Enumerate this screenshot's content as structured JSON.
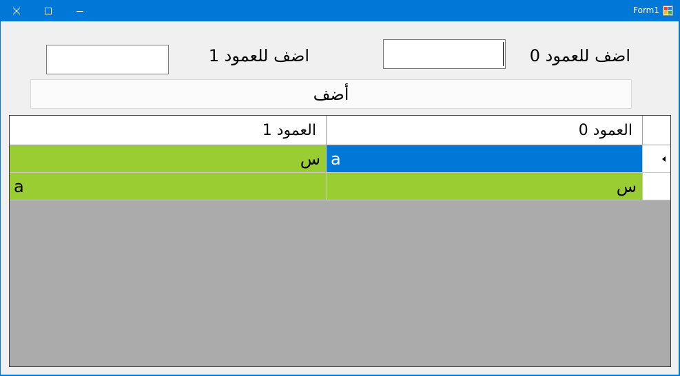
{
  "window": {
    "title": "Form1"
  },
  "form": {
    "label_col0": "اضف للعمود 0",
    "label_col1": "اضف للعمود  1",
    "textbox_col0_value": "",
    "textbox_col1_value": "",
    "add_button_label": "أضف"
  },
  "grid": {
    "headers": [
      "العمود 0",
      "العمود 1"
    ],
    "rows": [
      {
        "col0": "a",
        "col1": "س",
        "selected_col": 0
      },
      {
        "col0": "س",
        "col1": "a",
        "selected_col": -1
      }
    ],
    "current_row_indicator": "▸"
  },
  "colors": {
    "titlebar": "#0078d7",
    "client_bg": "#f0f0f0",
    "cell_green": "#9acd32",
    "selection_blue": "#0078d7",
    "grid_bg": "#ababab"
  }
}
